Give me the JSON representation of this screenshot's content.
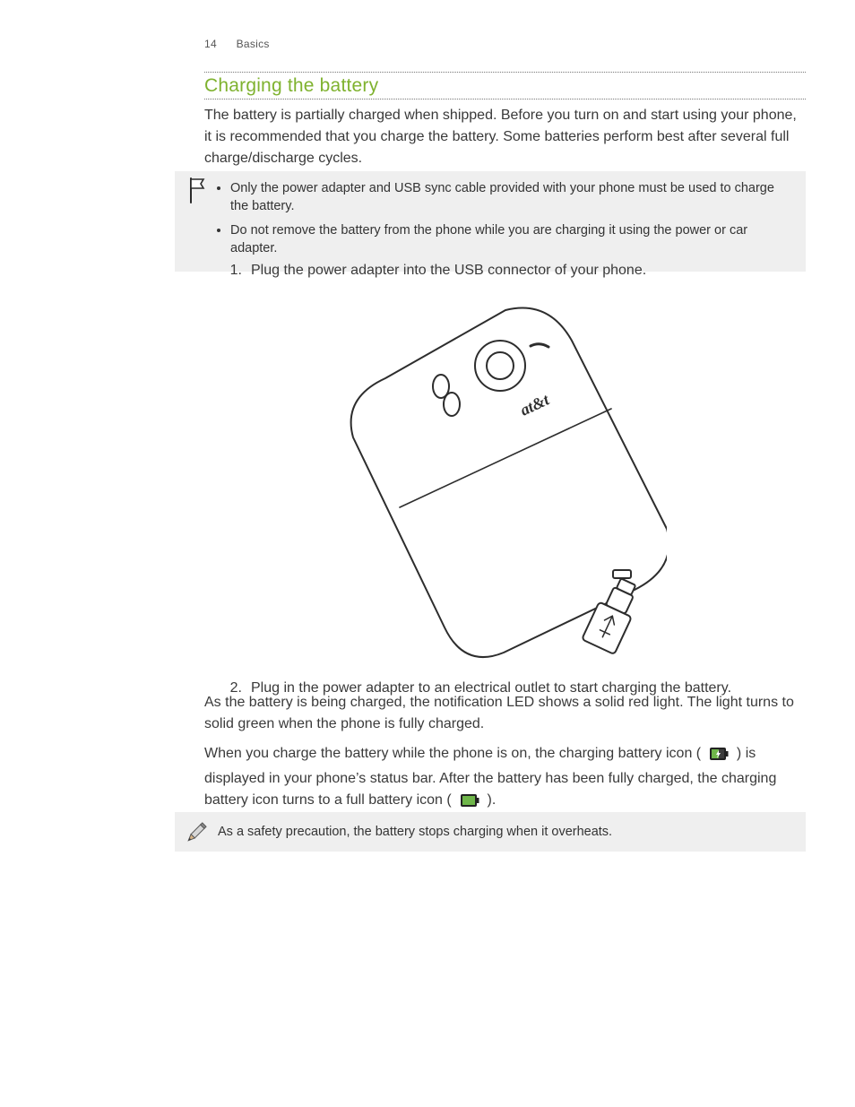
{
  "header": {
    "page_number": "14",
    "chapter": "Basics"
  },
  "title": "Charging the battery",
  "intro": "The battery is partially charged when shipped. Before you turn on and start using your phone, it is recommended that you charge the battery. Some batteries perform best after several full charge/discharge cycles.",
  "caution": {
    "items": [
      "Only the power adapter and USB sync cable provided with your phone must be used to charge the battery.",
      "Do not remove the battery from the phone while you are charging it using the power or car adapter."
    ]
  },
  "steps": {
    "1": "Plug the power adapter into the USB connector of your phone.",
    "2": "Plug in the power adapter to an electrical outlet to start charging the battery."
  },
  "illustration_label": "at&t",
  "after_steps_1": "As the battery is being charged, the notification LED shows a solid red light. The light turns to solid green when the phone is fully charged.",
  "icon_para": {
    "a": "When you charge the battery while the phone is on, the charging battery icon ( ",
    "b": " ) is displayed in your phone’s status bar. After the battery has been fully charged, the charging battery icon turns to a full battery icon ( ",
    "c": " )."
  },
  "note": "As a safety precaution, the battery stops charging when it overheats."
}
